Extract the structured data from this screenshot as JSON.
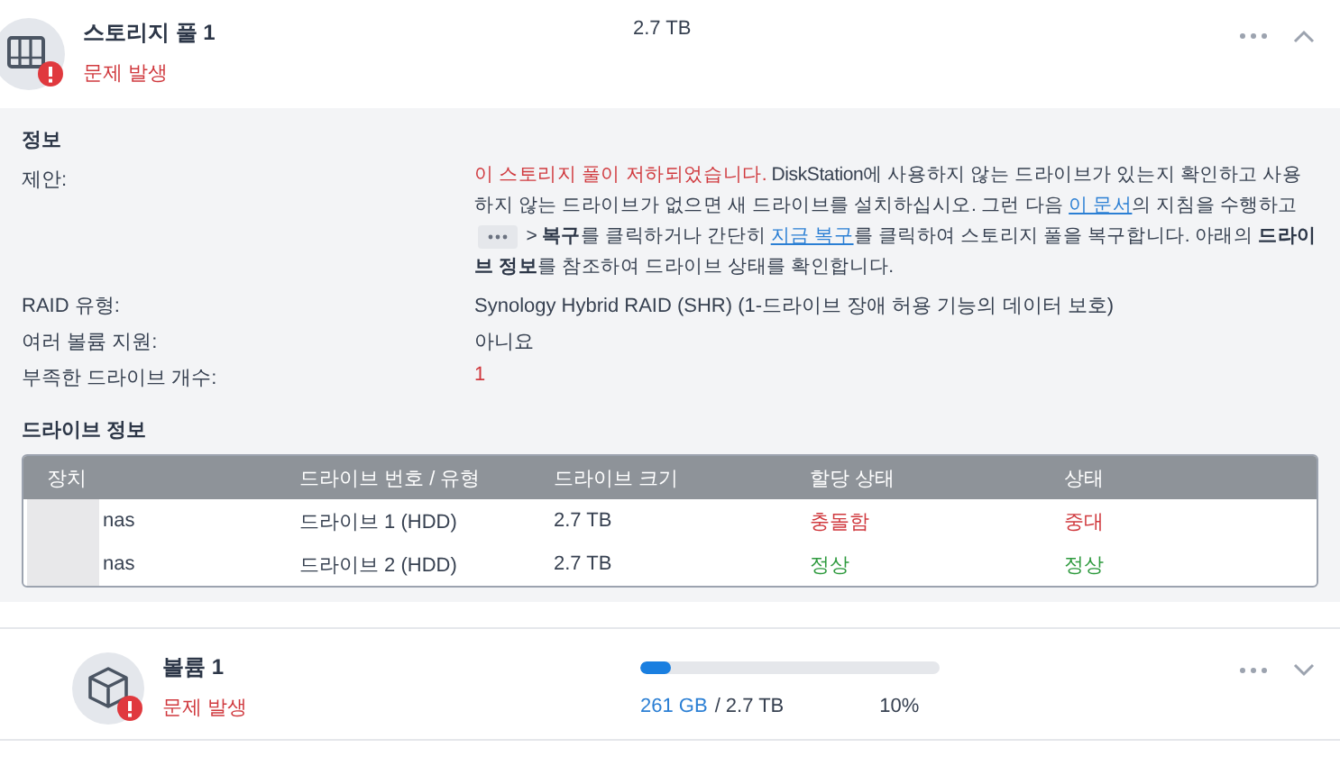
{
  "pool": {
    "title": "스토리지 풀 1",
    "status": "문제 발생",
    "alert": true,
    "size": "2.7 TB",
    "expanded": true
  },
  "info": {
    "heading": "정보",
    "suggestion_label": "제안:",
    "suggestion": [
      {
        "kind": "warning",
        "text": "이 스토리지 풀이 저하되었습니다."
      },
      {
        "kind": "text",
        "text": " DiskStation에 사용하지 않는 드라이브가 있는지 확인하고 사용하지 않는 드라이브가 없으면 새 드라이브를 설치하십시오. 그런 다음 "
      },
      {
        "kind": "link",
        "text": "이 문서"
      },
      {
        "kind": "text",
        "text": "의 지침을 수행하고 "
      },
      {
        "kind": "chip"
      },
      {
        "kind": "text",
        "text": " > **복구**를 클릭하거나 간단히 "
      },
      {
        "kind": "link",
        "text": "지금 복구"
      },
      {
        "kind": "text",
        "text": "를 클릭하여 스토리지 풀을 복구합니다. 아래의 **드라이브 정보**를 참조하여 드라이브 상태를 확인합니다."
      }
    ],
    "fields": [
      {
        "label": "RAID 유형:",
        "value": "Synology Hybrid RAID (SHR) (1-드라이브 장애 허용 기능의 데이터 보호)"
      },
      {
        "label": "여러 볼륨 지원:",
        "value": "아니요"
      },
      {
        "label": "부족한 드라이브 개수:",
        "value": "1",
        "color": "#d0393e"
      }
    ]
  },
  "drives": {
    "heading": "드라이브 정보",
    "columns": [
      "장치",
      "드라이브 번호 / 유형",
      "드라이브 크기",
      "할당 상태",
      "상태"
    ],
    "rows": [
      {
        "device": "nas",
        "drive": "드라이브 1 (HDD)",
        "size": "2.7 TB",
        "allocation": {
          "text": "충돌함",
          "color": "#d0393e"
        },
        "status": {
          "text": "중대",
          "color": "#d0393e"
        }
      },
      {
        "device": "nas",
        "drive": "드라이브 2 (HDD)",
        "size": "2.7 TB",
        "allocation": {
          "text": "정상",
          "color": "#2e9a3e"
        },
        "status": {
          "text": "정상",
          "color": "#2e9a3e"
        }
      }
    ]
  },
  "volume": {
    "title": "볼륨 1",
    "status": "문제 발생",
    "alert": true,
    "level": 0.1,
    "used": "261 GB",
    "total": "/ 2.7 TB",
    "percent": "10%",
    "expanded": false
  }
}
